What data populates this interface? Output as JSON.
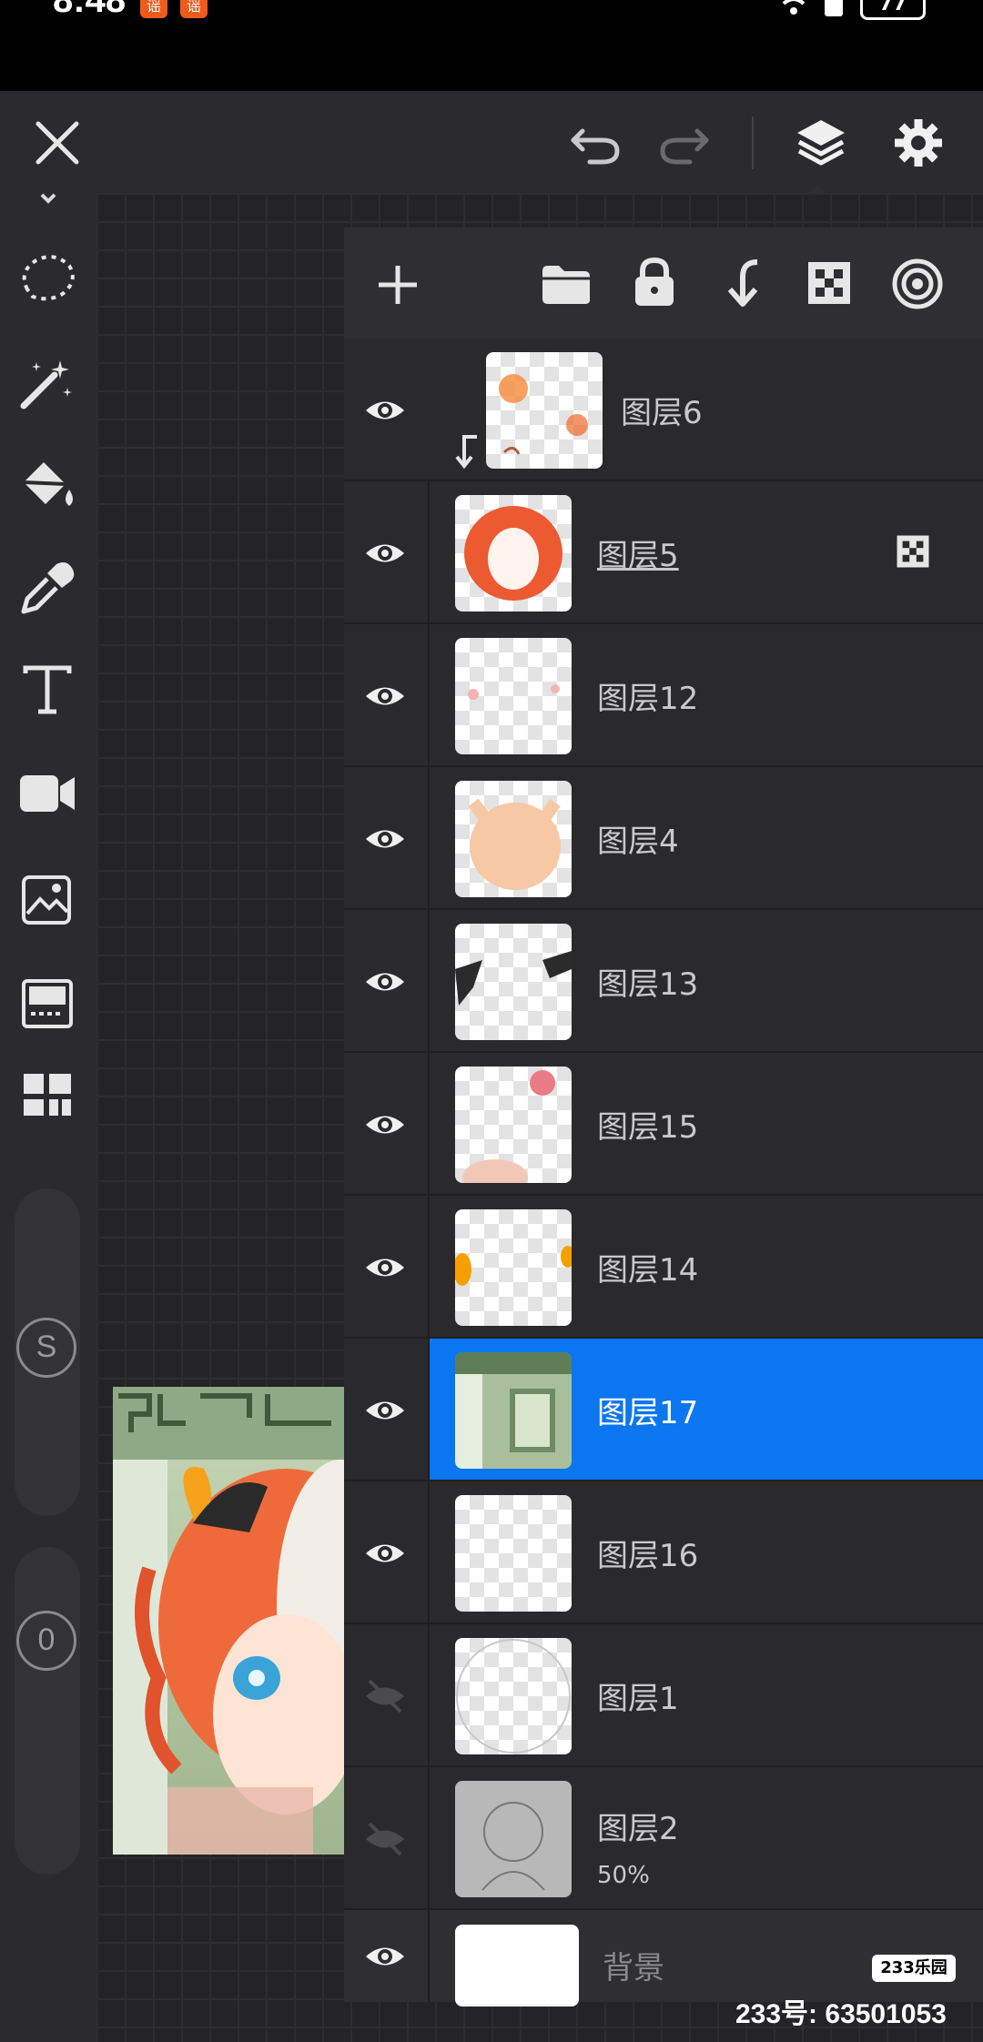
{
  "status_bar": {
    "time": "8:48",
    "notification_badge": "谣",
    "battery": "77"
  },
  "toolbar": {
    "close_icon": "close-icon",
    "undo_icon": "undo-icon",
    "redo_icon": "redo-icon",
    "layers_icon": "layers-icon",
    "settings_icon": "gear-icon"
  },
  "left_tools": [
    {
      "name": "lasso-tool",
      "icon": "lasso-icon"
    },
    {
      "name": "magic-wand-tool",
      "icon": "magic-wand-icon"
    },
    {
      "name": "fill-tool",
      "icon": "paint-bucket-icon"
    },
    {
      "name": "eyedropper-tool",
      "icon": "eyedropper-icon"
    },
    {
      "name": "text-tool",
      "icon": "text-icon"
    },
    {
      "name": "video-tool",
      "icon": "video-camera-icon"
    },
    {
      "name": "import-image-tool",
      "icon": "image-import-icon"
    },
    {
      "name": "frame-tool",
      "icon": "frame-icon"
    },
    {
      "name": "panels-tool",
      "icon": "panels-icon"
    }
  ],
  "size_slider_label": "S",
  "opacity_slider_label": "0",
  "layer_panel": {
    "toolbar": [
      "add-icon",
      "folder-icon",
      "lock-icon",
      "merge-down-icon",
      "checkerboard-icon",
      "target-icon"
    ],
    "layers": [
      {
        "name": "图层6",
        "visible": true,
        "clipped": true,
        "selected": false
      },
      {
        "name": "图层5",
        "visible": true,
        "clipped": false,
        "selected": false,
        "alpha_lock": true
      },
      {
        "name": "图层12",
        "visible": true,
        "clipped": false,
        "selected": false
      },
      {
        "name": "图层4",
        "visible": true,
        "clipped": false,
        "selected": false
      },
      {
        "name": "图层13",
        "visible": true,
        "clipped": false,
        "selected": false
      },
      {
        "name": "图层15",
        "visible": true,
        "clipped": false,
        "selected": false
      },
      {
        "name": "图层14",
        "visible": true,
        "clipped": false,
        "selected": false
      },
      {
        "name": "图层17",
        "visible": true,
        "clipped": false,
        "selected": true
      },
      {
        "name": "图层16",
        "visible": true,
        "clipped": false,
        "selected": false
      },
      {
        "name": "图层1",
        "visible": false,
        "clipped": false,
        "selected": false
      },
      {
        "name": "图层2",
        "visible": false,
        "clipped": false,
        "selected": false,
        "opacity": "50%"
      },
      {
        "name": "背景",
        "visible": true,
        "clipped": false,
        "selected": false
      }
    ]
  },
  "watermark": {
    "logo": "233乐园",
    "id_text": "233号: 63501053"
  },
  "colors": {
    "selection_blue": "#0a76f0",
    "panel_bg": "#2a2a2c",
    "toolbar_bg": "#2b2b2d"
  }
}
